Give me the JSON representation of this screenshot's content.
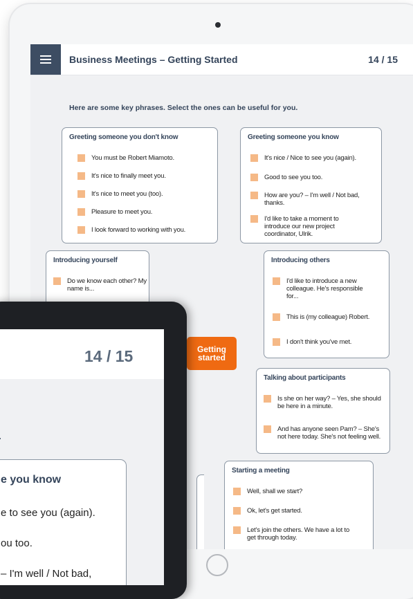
{
  "header": {
    "title": "Business Meetings – Getting Started",
    "page": "14 / 15"
  },
  "intro": "Here are some key phrases. Select the ones can be useful for you.",
  "center_button": {
    "line1": "Getting",
    "line2": "started"
  },
  "cards": {
    "greeting_unknown": {
      "title": "Greeting someone you don't know",
      "items": [
        "You must be Robert Miamoto.",
        "It's nice to finally meet you.",
        "It's nice to meet you (too).",
        "Pleasure to meet you.",
        "I look forward to working with you."
      ]
    },
    "greeting_known": {
      "title": "Greeting someone you know",
      "items": [
        "It's nice / Nice to see you (again).",
        "Good to see you too.",
        "How are you? – I'm well / Not bad, thanks.",
        "I'd like to take a moment to introduce our new project coordinator, Ulrik."
      ]
    },
    "introducing_yourself": {
      "title": "Introducing yourself",
      "items": [
        "Do we know each other? My name is..."
      ]
    },
    "introducing_others": {
      "title": "Introducing others",
      "items": [
        "I'd like to introduce a new colleague. He's responsible for...",
        "This is (my colleague) Robert.",
        "I don't think you've met."
      ]
    },
    "talking_participants": {
      "title": "Talking about participants",
      "items": [
        "Is she on her way? – Yes, she should be here in a minute.",
        "And has anyone seen Pam? – She's not here today. She's not feeling well."
      ]
    },
    "starting_meeting": {
      "title": "Starting a meeting",
      "items": [
        "Well, shall we start?",
        "Ok, let's get started.",
        "Let's join the others. We have a lot to get through today."
      ]
    }
  },
  "front": {
    "page": "14 / 15",
    "dot": ".",
    "card_title": "e you know",
    "items": [
      "e to see you (again).",
      "ou too.",
      "– I'm well / Not bad,"
    ]
  },
  "colors": {
    "accent": "#ef6a12",
    "checkbox": "#f5b987",
    "menu_bg": "#3d4d63",
    "title_text": "#34445a"
  },
  "icons": {
    "menu": "hamburger-menu-icon",
    "home": "home-button-icon",
    "camera": "camera-icon"
  }
}
